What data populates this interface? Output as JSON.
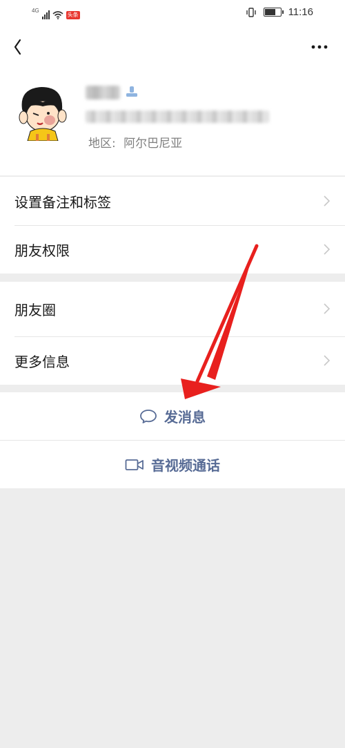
{
  "status_bar": {
    "network_label": "4G",
    "app_badge": "头条",
    "time": "11:16",
    "battery_level": 0.72
  },
  "topbar": {
    "back_icon": "chevron-left-icon",
    "more_icon": "ellipsis-icon"
  },
  "profile": {
    "avatar_icon": "cartoon-girl-avatar",
    "tag_icon": "user-tag-icon",
    "region_label": "地区:",
    "region_value": "阿尔巴尼亚"
  },
  "menu_group_1": [
    {
      "label": "设置备注和标签"
    },
    {
      "label": "朋友权限"
    }
  ],
  "menu_group_2": [
    {
      "label": "朋友圈"
    },
    {
      "label": "更多信息"
    }
  ],
  "actions": {
    "message_label": "发消息",
    "message_icon": "chat-bubble-icon",
    "call_label": "音视频通话",
    "call_icon": "video-camera-icon"
  },
  "colors": {
    "link_blue": "#576b95",
    "background": "#ededed",
    "annotation_arrow": "#e8201e"
  }
}
